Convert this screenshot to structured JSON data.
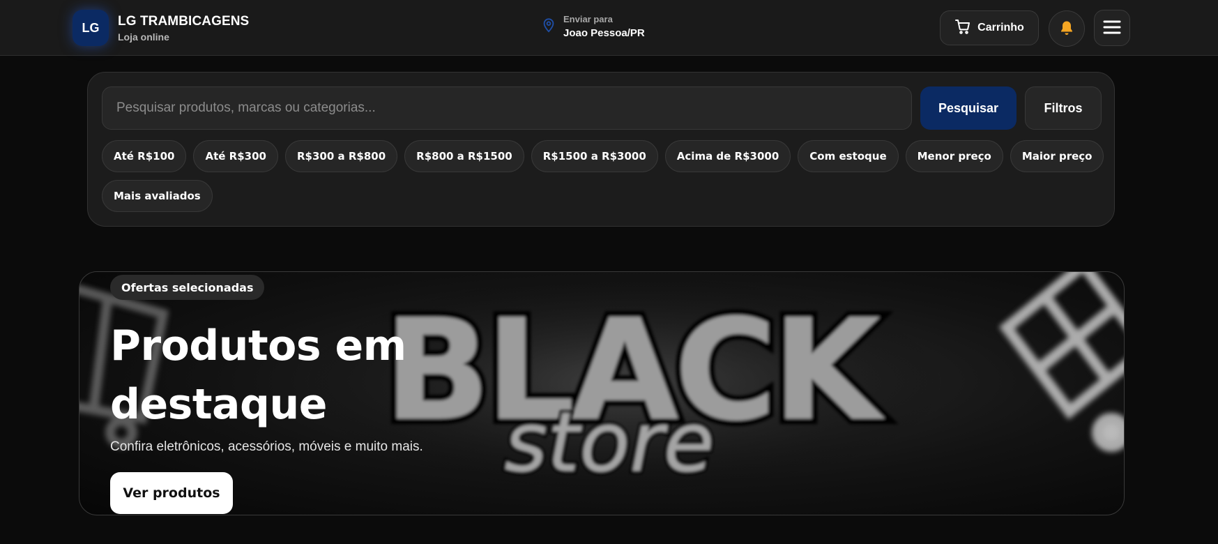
{
  "header": {
    "logo_text": "LG",
    "brand_name": "LG TRAMBICAGENS",
    "brand_subtitle": "Loja online",
    "location_label": "Enviar para",
    "location_value": "Joao Pessoa/PR",
    "cart_label": "Carrinho",
    "icons": {
      "location": "map-pin-icon",
      "cart": "cart-icon",
      "bell": "bell-icon",
      "menu": "hamburger-menu-icon"
    }
  },
  "search": {
    "placeholder": "Pesquisar produtos, marcas ou categorias...",
    "value": "",
    "submit_label": "Pesquisar",
    "filters_label": "Filtros",
    "chips": [
      "Até R$100",
      "Até R$300",
      "R$300 a R$800",
      "R$800 a R$1500",
      "R$1500 a R$3000",
      "Acima de R$3000",
      "Com estoque",
      "Menor preço",
      "Maior preço",
      "Mais avaliados"
    ]
  },
  "hero": {
    "badge": "Ofertas selecionadas",
    "title": "Produtos em destaque",
    "subtitle": "Confira eletrônicos, acessórios, móveis e muito mais.",
    "cta_label": "Ver produtos",
    "banner_word": "BLACK",
    "banner_script": "store"
  },
  "colors": {
    "brand_blue": "#0b2a63",
    "background": "#0b0b0b",
    "surface": "#1c1c1c",
    "bell": "#f5a623"
  }
}
